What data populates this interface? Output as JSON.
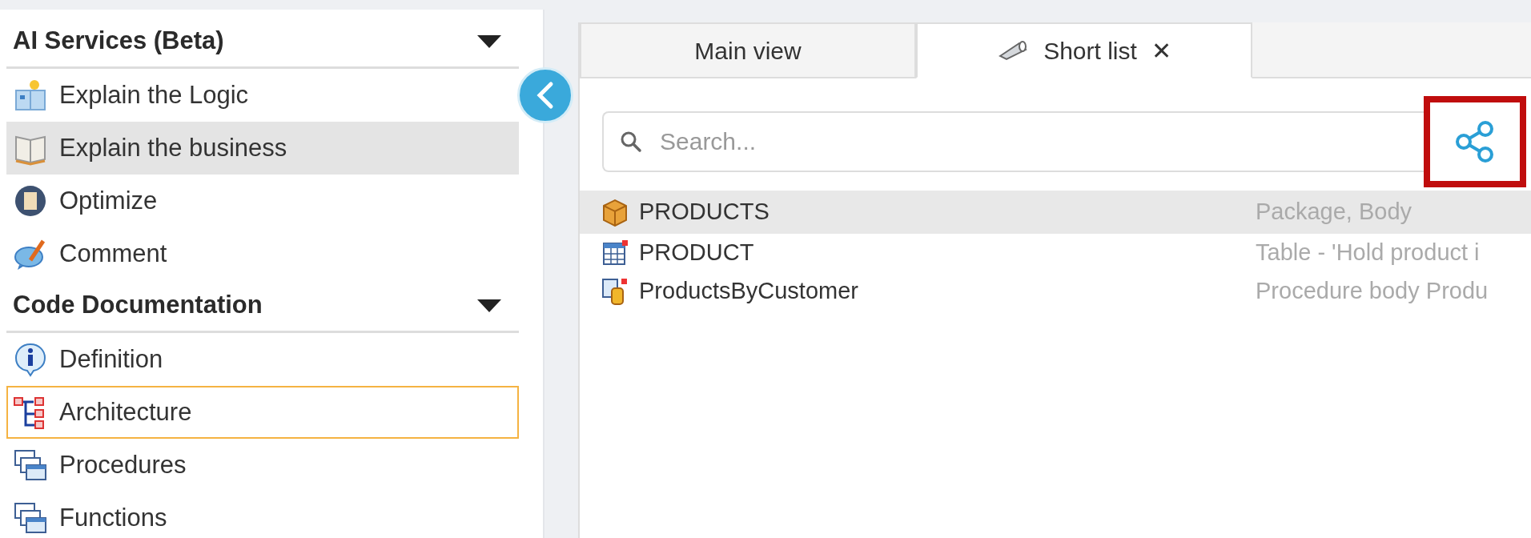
{
  "sidebar": {
    "sections": [
      {
        "title": "AI Services (Beta)",
        "expanded": true,
        "items": [
          {
            "label": "Explain the Logic",
            "selected": false,
            "focused": false
          },
          {
            "label": "Explain the business",
            "selected": true,
            "focused": false
          },
          {
            "label": "Optimize",
            "selected": false,
            "focused": false
          },
          {
            "label": "Comment",
            "selected": false,
            "focused": false
          }
        ]
      },
      {
        "title": "Code Documentation",
        "expanded": true,
        "items": [
          {
            "label": "Definition",
            "selected": false,
            "focused": false
          },
          {
            "label": "Architecture",
            "selected": false,
            "focused": true
          },
          {
            "label": "Procedures",
            "selected": false,
            "focused": false
          },
          {
            "label": "Functions",
            "selected": false,
            "focused": false
          }
        ]
      }
    ]
  },
  "tabs": [
    {
      "label": "Main view",
      "selected": false,
      "closable": false
    },
    {
      "label": "Short list",
      "selected": true,
      "closable": true,
      "close_symbol": "✕"
    }
  ],
  "search": {
    "placeholder": "Search..."
  },
  "share_button": {
    "highlighted": true
  },
  "results": [
    {
      "name": "PRODUCTS",
      "description": "Package, Body",
      "selected": true
    },
    {
      "name": "PRODUCT",
      "description": "Table - 'Hold product i",
      "selected": false
    },
    {
      "name": "ProductsByCustomer",
      "description": "Procedure body Produ",
      "selected": false
    }
  ]
}
